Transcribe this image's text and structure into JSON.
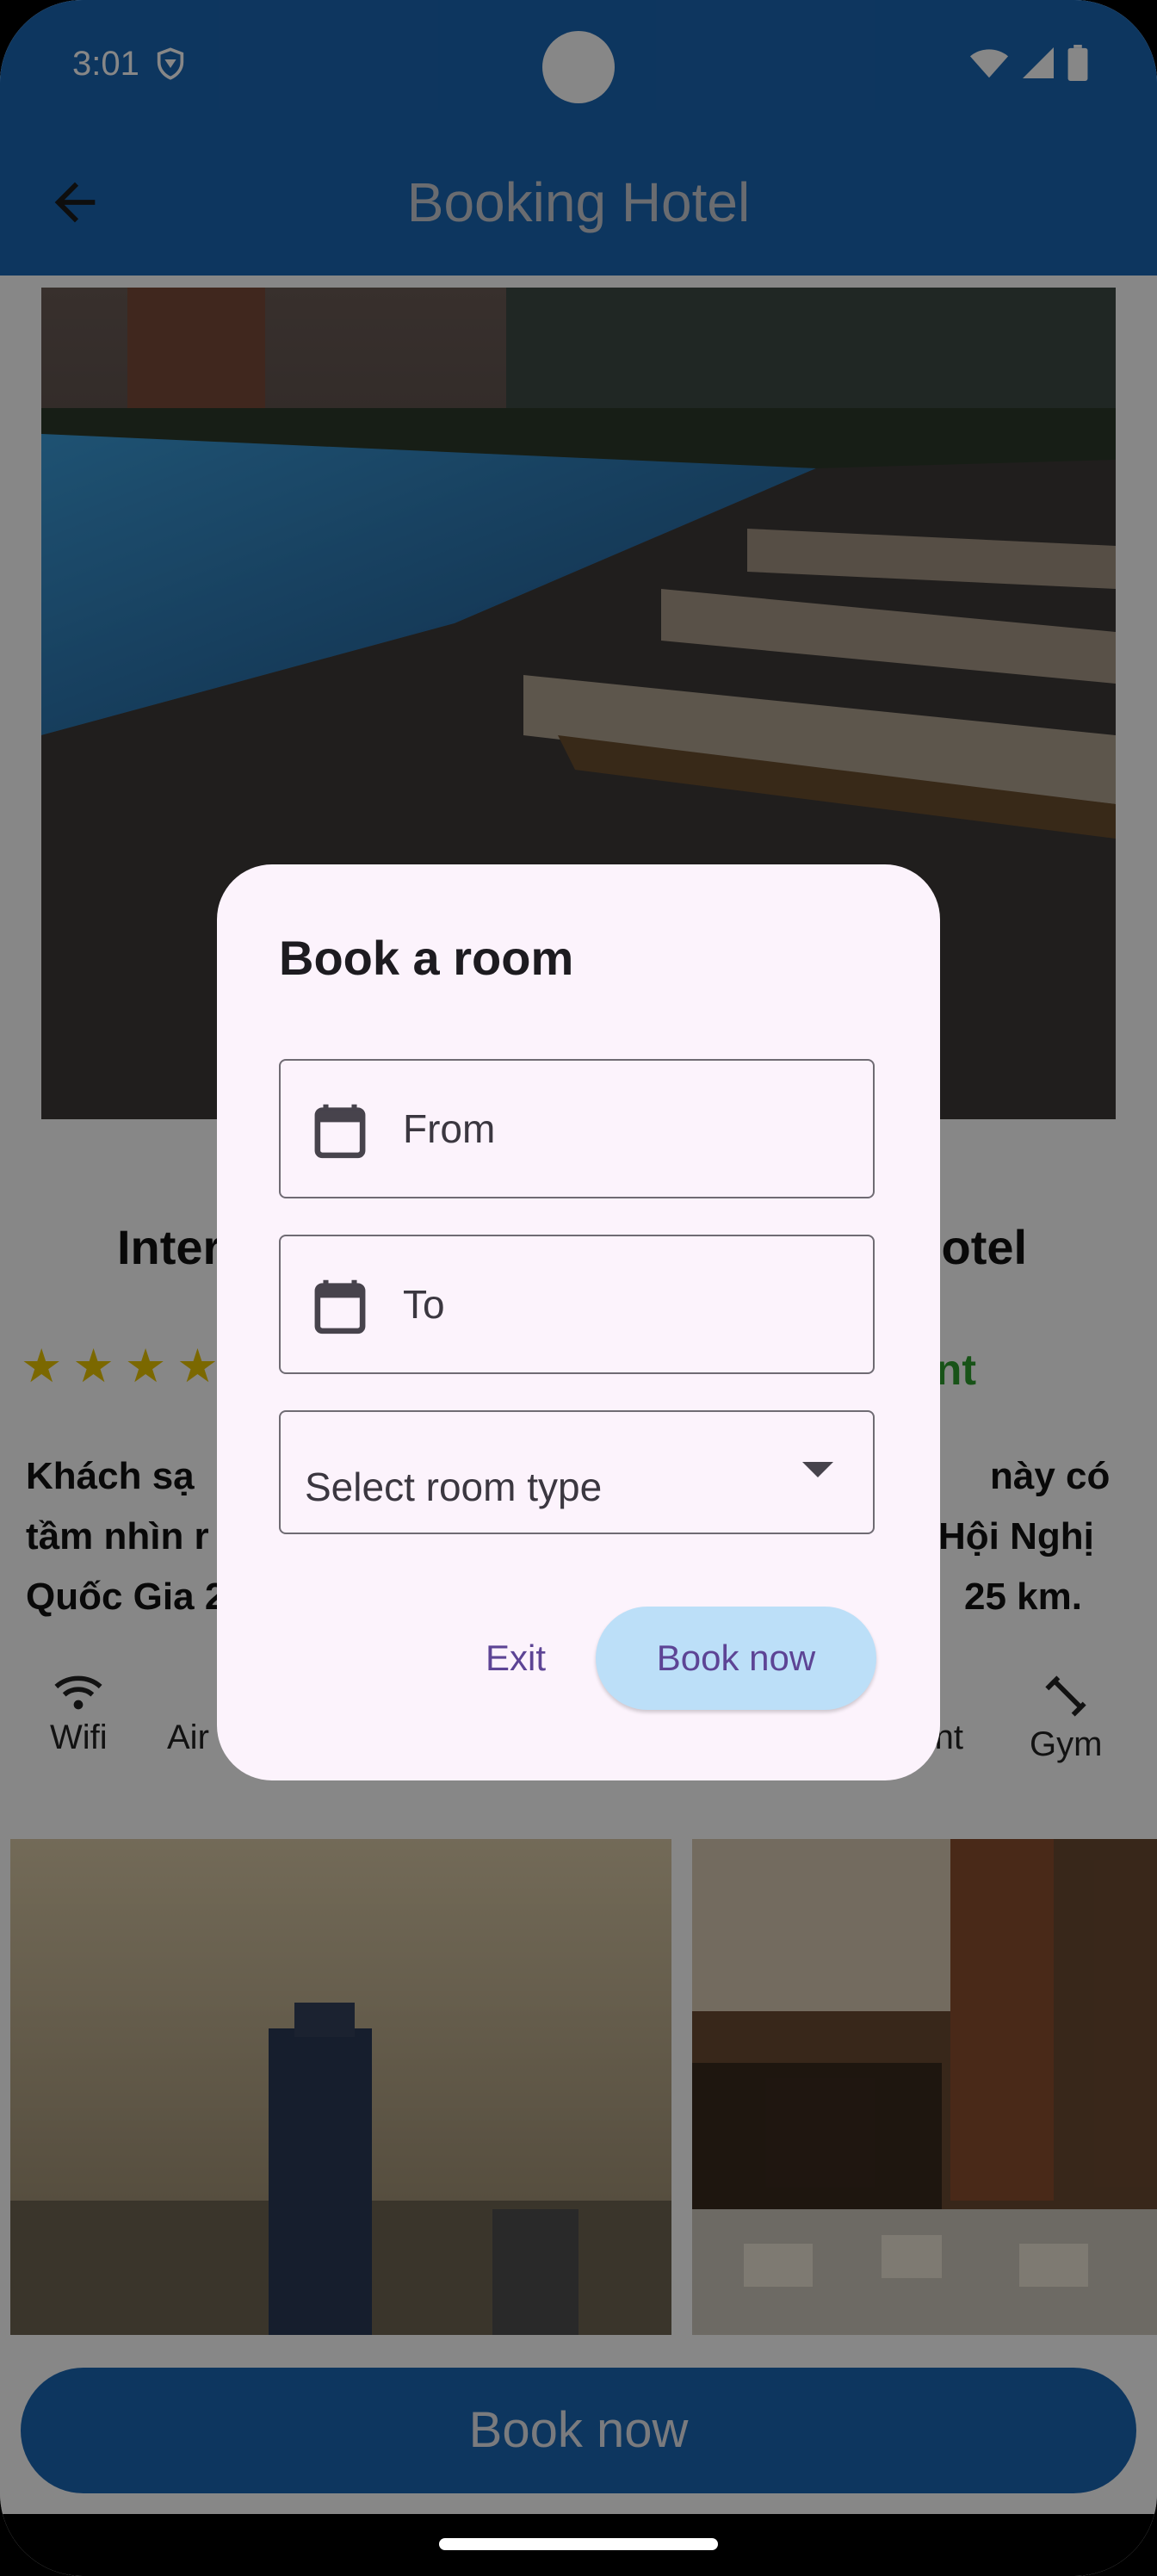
{
  "status_bar": {
    "time": "3:01",
    "icons": [
      "shield-icon",
      "wifi-icon",
      "signal-icon",
      "battery-icon"
    ]
  },
  "app_bar": {
    "title": "Booking Hotel",
    "back_icon": "arrow-back-icon"
  },
  "hotel": {
    "name_left": "Inter",
    "name_right": "lotel",
    "star_count": 4,
    "rating_text_visible": "nt",
    "description_lines": [
      " Khách sạ",
      "tầm nhìn r",
      "Quốc Gia 2"
    ],
    "description_right_lines": [
      "này có",
      "Hội Nghị",
      "25 km."
    ]
  },
  "amenities": [
    {
      "label": "Wifi",
      "icon": "wifi-icon"
    },
    {
      "label": "Air C",
      "icon": "air-conditioner-icon"
    },
    {
      "label": "rant",
      "icon": "restaurant-icon"
    },
    {
      "label": "Gym",
      "icon": "gym-icon"
    }
  ],
  "main_button_label": "Book now",
  "dialog": {
    "title": "Book a room",
    "from_placeholder": "From",
    "to_placeholder": "To",
    "room_type_placeholder": "Select room type",
    "exit_label": "Exit",
    "book_label": "Book now"
  },
  "colors": {
    "app_bar": "#1a66b4",
    "dialog_bg": "#fcf3fc",
    "primary_text": "#5d4495",
    "book_button_bg": "#bcdff8",
    "star": "#e8c400",
    "rating_green": "#2e9e2e"
  }
}
